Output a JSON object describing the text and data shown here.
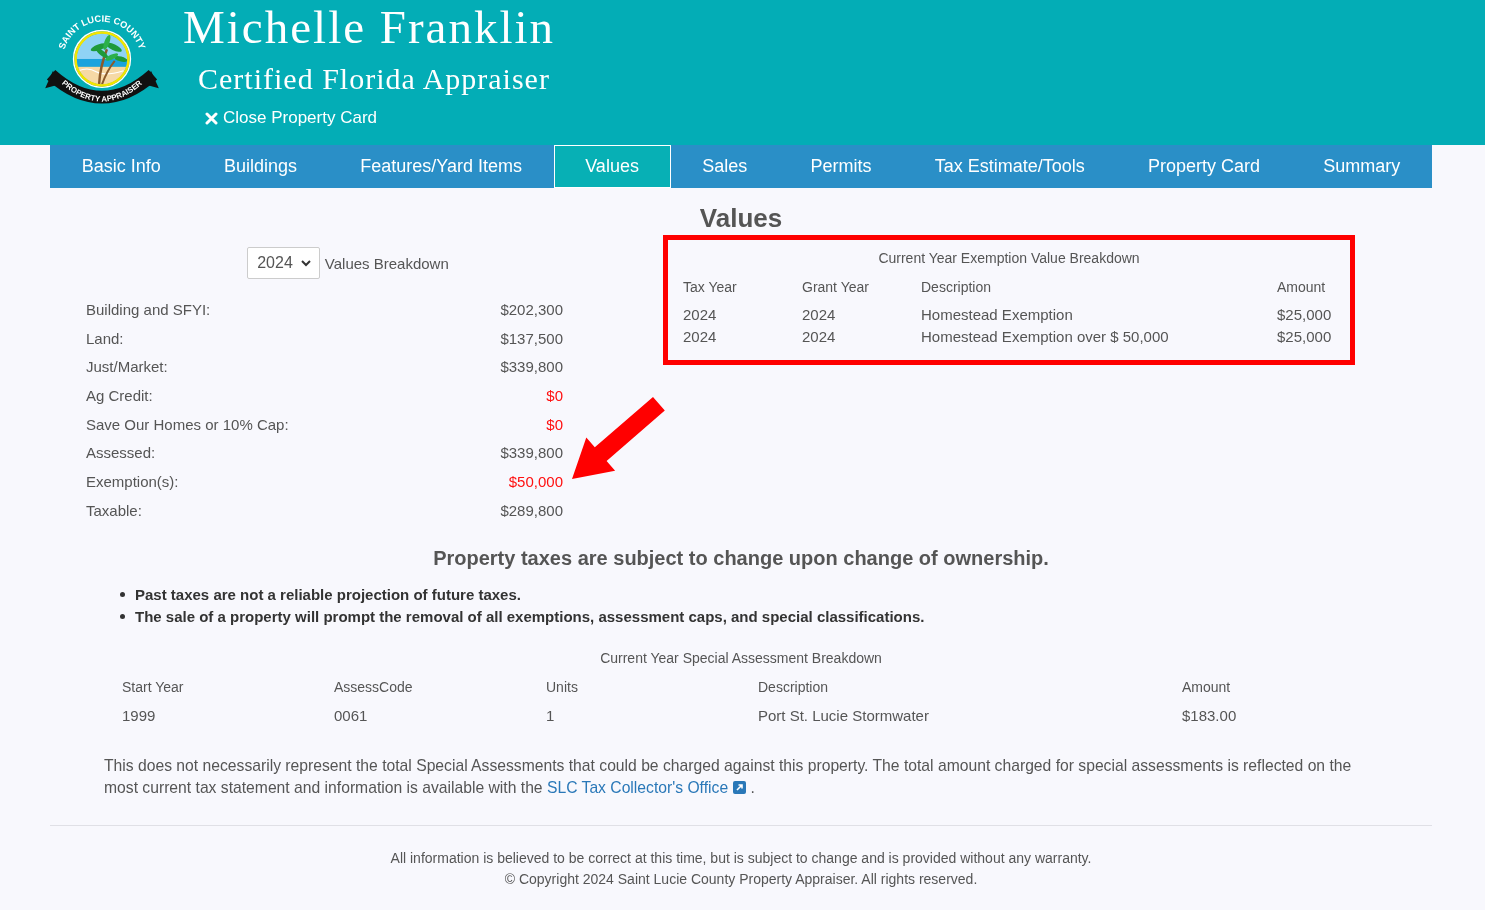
{
  "header": {
    "logo": {
      "top_text": "SAINT LUCIE COUNTY",
      "bottom_text": "PROPERTY APPRAISER"
    },
    "title": "Michelle Franklin",
    "subtitle": "Certified Florida Appraiser",
    "close_link": "Close Property Card"
  },
  "tabs": [
    {
      "label": "Basic Info",
      "selected": false
    },
    {
      "label": "Buildings",
      "selected": false
    },
    {
      "label": "Features/Yard Items",
      "selected": false
    },
    {
      "label": "Values",
      "selected": true
    },
    {
      "label": "Sales",
      "selected": false
    },
    {
      "label": "Permits",
      "selected": false
    },
    {
      "label": "Tax Estimate/Tools",
      "selected": false
    },
    {
      "label": "Property Card",
      "selected": false
    },
    {
      "label": "Summary",
      "selected": false
    }
  ],
  "heading": "Values",
  "values_breakdown": {
    "year_select": "2024",
    "label": "Values Breakdown",
    "rows": [
      {
        "label": "Building and SFYI:",
        "value": "$202,300",
        "alert": false,
        "arrow": false
      },
      {
        "label": "Land:",
        "value": "$137,500",
        "alert": false,
        "arrow": false
      },
      {
        "label": "Just/Market:",
        "value": "$339,800",
        "alert": false,
        "arrow": false
      },
      {
        "label": "Ag Credit:",
        "value": "$0",
        "alert": true,
        "arrow": false
      },
      {
        "label": "Save Our Homes or 10% Cap:",
        "value": "$0",
        "alert": true,
        "arrow": false
      },
      {
        "label": "Assessed:",
        "value": "$339,800",
        "alert": false,
        "arrow": false
      },
      {
        "label": "Exemption(s):",
        "value": "$50,000",
        "alert": true,
        "arrow": true
      },
      {
        "label": "Taxable:",
        "value": "$289,800",
        "alert": false,
        "arrow": false
      }
    ]
  },
  "exemptions": {
    "highlighted": true,
    "title": "Current Year Exemption Value Breakdown",
    "columns": [
      "Tax Year",
      "Grant Year",
      "Description",
      "Amount"
    ],
    "rows": [
      [
        "2024",
        "2024",
        "Homestead Exemption",
        "$25,000"
      ],
      [
        "2024",
        "2024",
        "Homestead Exemption over $ 50,000",
        "$25,000"
      ]
    ]
  },
  "notice": {
    "heading": "Property taxes are subject to change upon change of ownership.",
    "bullets": [
      "Past taxes are not a reliable projection of future taxes.",
      "The sale of a property will prompt the removal of all exemptions, assessment caps, and special classifications."
    ]
  },
  "special_assessments": {
    "title": "Current Year Special Assessment Breakdown",
    "columns": [
      "Start Year",
      "AssessCode",
      "Units",
      "Description",
      "Amount"
    ],
    "rows": [
      [
        "1999",
        "0061",
        "1",
        "Port St. Lucie Stormwater",
        "$183.00"
      ]
    ]
  },
  "disclaimer": {
    "text": "This does not necessarily represent the total Special Assessments that could be charged against this property. The total amount charged for special assessments is reflected on the most current tax statement and information is available with the",
    "link": "SLC Tax Collector's Office",
    "end": "."
  },
  "footer": {
    "lines": [
      "All information is believed to be correct at this time, but is subject to change and is provided without any warranty.",
      "© Copyright 2024 Saint Lucie County Property Appraiser. All rights reserved."
    ]
  }
}
